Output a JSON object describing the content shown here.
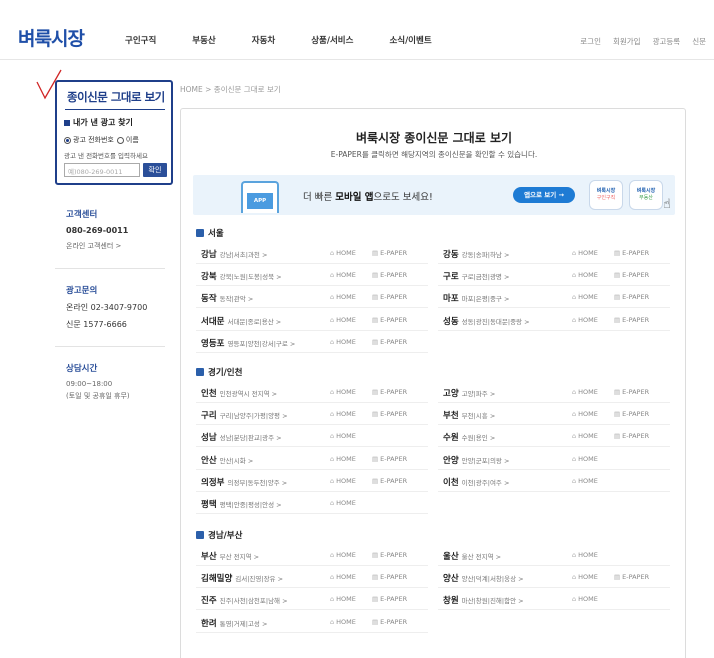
{
  "logo": "벼룩시장",
  "nav": [
    "구인구직",
    "부동산",
    "자동차",
    "상품/서비스",
    "소식/이벤트"
  ],
  "util": [
    "로그인",
    "회원가입",
    "광고등록",
    "신문"
  ],
  "sidebar": {
    "title": "종이신문 그대로 보기",
    "my_ad": "내가 낸 광고 찾기",
    "radio_phone": "광고 전화번호",
    "radio_name": "이름",
    "hint": "광고 낸 전화번호를 입력하세요",
    "input_placeholder": "예)080-269-0011",
    "search_button": "확인"
  },
  "customer_center": {
    "title": "고객센터",
    "phone": "080-269-0011",
    "online": "온라인 고객센터 >"
  },
  "ad_inquiry": {
    "title": "광고문의",
    "online": "온라인 02-3407-9700",
    "newspaper": "신문    1577-6666"
  },
  "hours": {
    "title": "상담시간",
    "time": "09:00~18:00",
    "note": "(토일 및 공휴일 휴무)"
  },
  "breadcrumb": "HOME > 종이신문 그대로 보기",
  "main": {
    "title": "벼룩시장 종이신문 그대로 보기",
    "subtitle": "E-PAPER를 클릭하면 해당지역의 종이신문을 확인할 수 있습니다."
  },
  "banner": {
    "app_label": "APP",
    "text_pre": "더 빠른 ",
    "text_bold": "모바일 앱",
    "text_post": "으로도 보세요!",
    "button": "앱으로 보기 →",
    "qr1_title": "벼룩시장",
    "qr1_sub": "구인구직",
    "qr2_title": "벼룩시장",
    "qr2_sub": "부동산"
  },
  "labels": {
    "home": "HOME",
    "epaper": "E-PAPER"
  },
  "regions": [
    {
      "name": "서울",
      "rows": [
        [
          {
            "n": "강남",
            "a": "강남|서초|과천 >",
            "ep": true
          },
          {
            "n": "강동",
            "a": "강동|송파|하남 >",
            "ep": true
          }
        ],
        [
          {
            "n": "강북",
            "a": "강북|노원|도봉|성북 >",
            "ep": true
          },
          {
            "n": "구로",
            "a": "구로|금천|광명 >",
            "ep": true
          }
        ],
        [
          {
            "n": "동작",
            "a": "동작|관악 >",
            "ep": true
          },
          {
            "n": "마포",
            "a": "마포|은평|중구 >",
            "ep": true
          }
        ],
        [
          {
            "n": "서대문",
            "a": "서대문|종로|용산 >",
            "ep": true
          },
          {
            "n": "성동",
            "a": "성동|광진|동대문|중랑 >",
            "ep": true
          }
        ],
        [
          {
            "n": "영등포",
            "a": "영등포|양천|강서|구로 >",
            "ep": true
          },
          null
        ]
      ]
    },
    {
      "name": "경기/인천",
      "rows": [
        [
          {
            "n": "인천",
            "a": "인천광역시 전지역 >",
            "ep": true
          },
          {
            "n": "고양",
            "a": "고양|파주 >",
            "ep": true
          }
        ],
        [
          {
            "n": "구리",
            "a": "구리|남양주|가평|양평 >",
            "ep": true
          },
          {
            "n": "부천",
            "a": "부천|시흥 >",
            "ep": true
          }
        ],
        [
          {
            "n": "성남",
            "a": "성남|분당|판교|광주 >",
            "ep": false
          },
          {
            "n": "수원",
            "a": "수원|용인 >",
            "ep": true
          }
        ],
        [
          {
            "n": "안산",
            "a": "안산|시화 >",
            "ep": true
          },
          {
            "n": "안양",
            "a": "안양|군포|의왕 >",
            "ep": false
          }
        ],
        [
          {
            "n": "의정부",
            "a": "의정부|동두천|양주 >",
            "ep": true
          },
          {
            "n": "이천",
            "a": "이천|광주|여주 >",
            "ep": false
          }
        ],
        [
          {
            "n": "평택",
            "a": "평택|안중|평성|안성 >",
            "ep": false
          },
          null
        ]
      ]
    },
    {
      "name": "경남/부산",
      "rows": [
        [
          {
            "n": "부산",
            "a": "부산 전지역 >",
            "ep": true
          },
          {
            "n": "울산",
            "a": "울산 전지역 >",
            "ep": false
          }
        ],
        [
          {
            "n": "김해밀양",
            "a": "김서|진영|장유 >",
            "ep": true
          },
          {
            "n": "양산",
            "a": "양산|덕계|서창|웅상 >",
            "ep": true
          }
        ],
        [
          {
            "n": "진주",
            "a": "진주|사천|삼천포|남해 >",
            "ep": true
          },
          {
            "n": "창원",
            "a": "마산|창원|진해|함안 >",
            "ep": false
          }
        ],
        [
          {
            "n": "한려",
            "a": "통영|거제|고성 >",
            "ep": true
          },
          null
        ]
      ]
    }
  ]
}
